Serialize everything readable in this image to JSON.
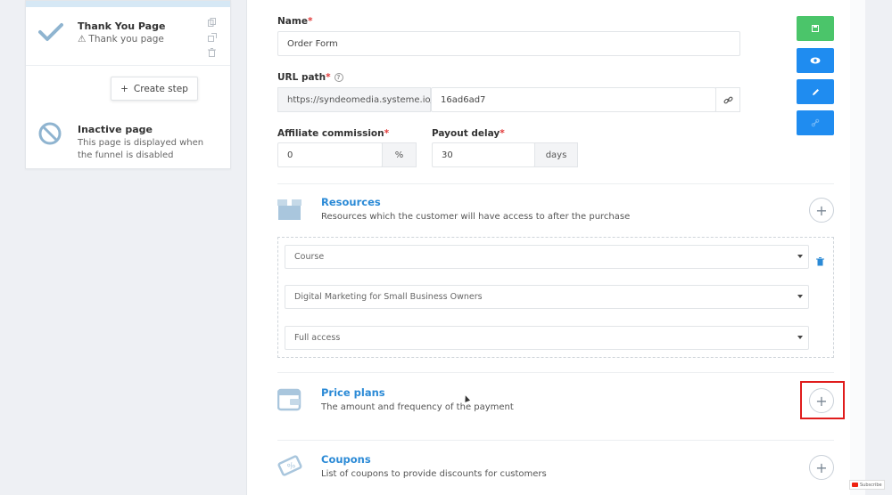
{
  "sidebar": {
    "step": {
      "title": "Thank You Page",
      "subtitle": "Thank you page",
      "warning_glyph": "⚠"
    },
    "create_step_label": "Create step",
    "inactive": {
      "title": "Inactive page",
      "description": "This page is displayed when the funnel is disabled"
    }
  },
  "form": {
    "name": {
      "label": "Name",
      "required": "*",
      "value": "Order Form"
    },
    "url_path": {
      "label": "URL path",
      "required": "*",
      "help": "?",
      "domain": "https://syndeomedia.systeme.io/",
      "slug": "16ad6ad7"
    },
    "affiliate": {
      "label": "Affiliate commission",
      "required": "*",
      "value": "0",
      "unit": "%"
    },
    "payout": {
      "label": "Payout delay",
      "required": "*",
      "value": "30",
      "unit": "days"
    }
  },
  "sections": {
    "resources": {
      "title": "Resources",
      "description": "Resources which the customer will have access to after the purchase"
    },
    "price_plans": {
      "title": "Price plans",
      "description": "The amount and frequency of the payment"
    },
    "coupons": {
      "title": "Coupons",
      "description": "List of coupons to provide discounts for customers"
    }
  },
  "resource_selects": [
    "Course",
    "Digital Marketing for Small Business Owners",
    "Full access"
  ],
  "badge": {
    "subscribe": "Subscribe"
  },
  "colors": {
    "accent": "#2b8ad6",
    "save": "#4bc56a",
    "blue_button": "#1f8cf0",
    "highlight": "#e01c1c"
  }
}
